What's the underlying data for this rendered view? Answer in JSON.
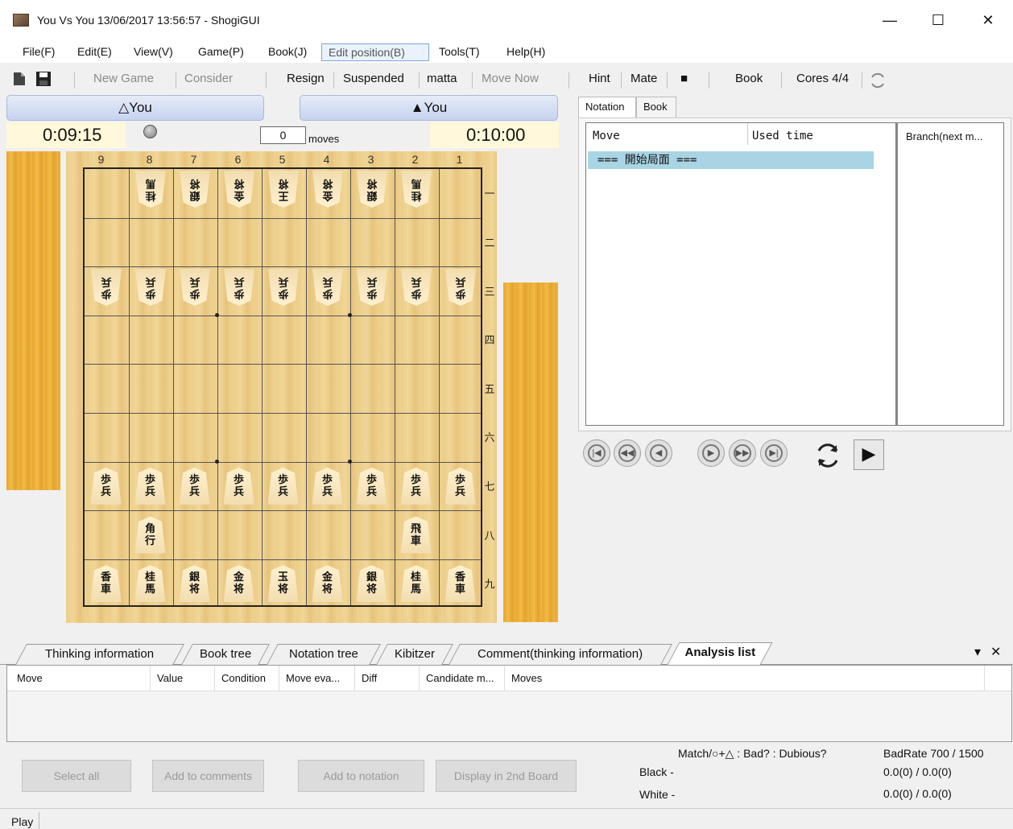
{
  "window": {
    "title": "You Vs You 13/06/2017 13:56:57 - ShogiGUI",
    "minimize": "—",
    "maximize": "☐",
    "close": "✕"
  },
  "menu": [
    "File(F)",
    "Edit(E)",
    "View(V)",
    "Game(P)",
    "Book(J)",
    "Edit position(B)",
    "Tools(T)",
    "Help(H)"
  ],
  "toolbar": {
    "new_game": "New Game",
    "consider": "Consider",
    "resign": "Resign",
    "suspended": "Suspended",
    "matta": "matta",
    "move_now": "Move Now",
    "hint": "Hint",
    "mate": "Mate",
    "stop": "■",
    "book": "Book",
    "cores": "Cores 4/4"
  },
  "players": {
    "white_name": "△You",
    "black_name": "▲You",
    "white_clock": "0:09:15",
    "black_clock": "0:10:00",
    "move_count": "0",
    "moves_label": "moves"
  },
  "board": {
    "files": [
      "9",
      "8",
      "7",
      "6",
      "5",
      "4",
      "3",
      "2",
      "1"
    ],
    "ranks": [
      "一",
      "二",
      "三",
      "四",
      "五",
      "六",
      "七",
      "八",
      "九"
    ],
    "pieces_gote": [
      {
        "file": 8,
        "rank": 1,
        "text": "桂馬"
      },
      {
        "file": 7,
        "rank": 1,
        "text": "銀将"
      },
      {
        "file": 6,
        "rank": 1,
        "text": "金将"
      },
      {
        "file": 5,
        "rank": 1,
        "text": "王将"
      },
      {
        "file": 4,
        "rank": 1,
        "text": "金将"
      },
      {
        "file": 3,
        "rank": 1,
        "text": "銀将"
      },
      {
        "file": 2,
        "rank": 1,
        "text": "桂馬"
      },
      {
        "file": 9,
        "rank": 3,
        "text": "歩兵"
      },
      {
        "file": 8,
        "rank": 3,
        "text": "歩兵"
      },
      {
        "file": 7,
        "rank": 3,
        "text": "歩兵"
      },
      {
        "file": 6,
        "rank": 3,
        "text": "歩兵"
      },
      {
        "file": 5,
        "rank": 3,
        "text": "歩兵"
      },
      {
        "file": 4,
        "rank": 3,
        "text": "歩兵"
      },
      {
        "file": 3,
        "rank": 3,
        "text": "歩兵"
      },
      {
        "file": 2,
        "rank": 3,
        "text": "歩兵"
      },
      {
        "file": 1,
        "rank": 3,
        "text": "歩兵"
      }
    ],
    "pieces_sente": [
      {
        "file": 9,
        "rank": 7,
        "text": "歩兵"
      },
      {
        "file": 8,
        "rank": 7,
        "text": "歩兵"
      },
      {
        "file": 7,
        "rank": 7,
        "text": "歩兵"
      },
      {
        "file": 6,
        "rank": 7,
        "text": "歩兵"
      },
      {
        "file": 5,
        "rank": 7,
        "text": "歩兵"
      },
      {
        "file": 4,
        "rank": 7,
        "text": "歩兵"
      },
      {
        "file": 3,
        "rank": 7,
        "text": "歩兵"
      },
      {
        "file": 2,
        "rank": 7,
        "text": "歩兵"
      },
      {
        "file": 1,
        "rank": 7,
        "text": "歩兵"
      },
      {
        "file": 8,
        "rank": 8,
        "text": "角行"
      },
      {
        "file": 2,
        "rank": 8,
        "text": "飛車"
      },
      {
        "file": 9,
        "rank": 9,
        "text": "香車"
      },
      {
        "file": 8,
        "rank": 9,
        "text": "桂馬"
      },
      {
        "file": 7,
        "rank": 9,
        "text": "銀将"
      },
      {
        "file": 6,
        "rank": 9,
        "text": "金将"
      },
      {
        "file": 5,
        "rank": 9,
        "text": "玉将"
      },
      {
        "file": 4,
        "rank": 9,
        "text": "金将"
      },
      {
        "file": 3,
        "rank": 9,
        "text": "銀将"
      },
      {
        "file": 2,
        "rank": 9,
        "text": "桂馬"
      },
      {
        "file": 1,
        "rank": 9,
        "text": "香車"
      }
    ]
  },
  "right_tabs": [
    "Notation",
    "Book"
  ],
  "notation": {
    "col_move": "Move",
    "col_time": "Used time",
    "col_branch": "Branch(next m...",
    "rows": [
      "=== 開始局面 ==="
    ]
  },
  "nav_icons": [
    "first-icon",
    "back-fast-icon",
    "back-icon",
    "forward-icon",
    "forward-fast-icon",
    "last-icon",
    "flip-board-icon",
    "play-icon"
  ],
  "bottom_tabs": [
    "Thinking information",
    "Book tree",
    "Notation tree",
    "Kibitzer",
    "Comment(thinking information)",
    "Analysis list"
  ],
  "bottom_controls": {
    "dropdown": "▾",
    "close": "✕"
  },
  "analysis": {
    "columns": [
      "Move",
      "Value",
      "Condition",
      "Move eva...",
      "Diff",
      "Candidate m...",
      "Moves"
    ]
  },
  "buttons": {
    "select_all": "Select all",
    "add_comments": "Add to comments",
    "add_notation": "Add to notation",
    "display_2nd": "Display in 2nd Board"
  },
  "stats": {
    "legend": "Match/○+△ : Bad? : Dubious?",
    "badrate": "BadRate 700 / 1500",
    "black_label": "Black -",
    "white_label": "White -",
    "black_value": "0.0(0) / 0.0(0)",
    "white_value": "0.0(0) / 0.0(0)"
  },
  "status": {
    "mode": "Play"
  }
}
